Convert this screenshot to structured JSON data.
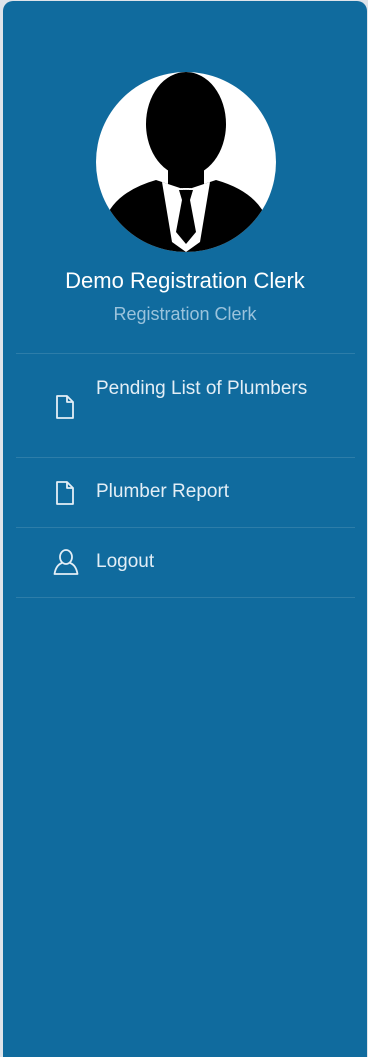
{
  "user": {
    "name": "Demo Registration Clerk",
    "role": "Registration Clerk"
  },
  "menu": {
    "items": [
      {
        "label": "Pending List of Plumbers",
        "icon": "file-icon"
      },
      {
        "label": "Plumber Report",
        "icon": "file-icon"
      },
      {
        "label": "Logout",
        "icon": "user-icon"
      }
    ]
  },
  "colors": {
    "sidebar_bg": "#106b9e",
    "page_bg": "#dfe4ea",
    "role_text": "#9bc3dc",
    "text": "#ffffff"
  }
}
